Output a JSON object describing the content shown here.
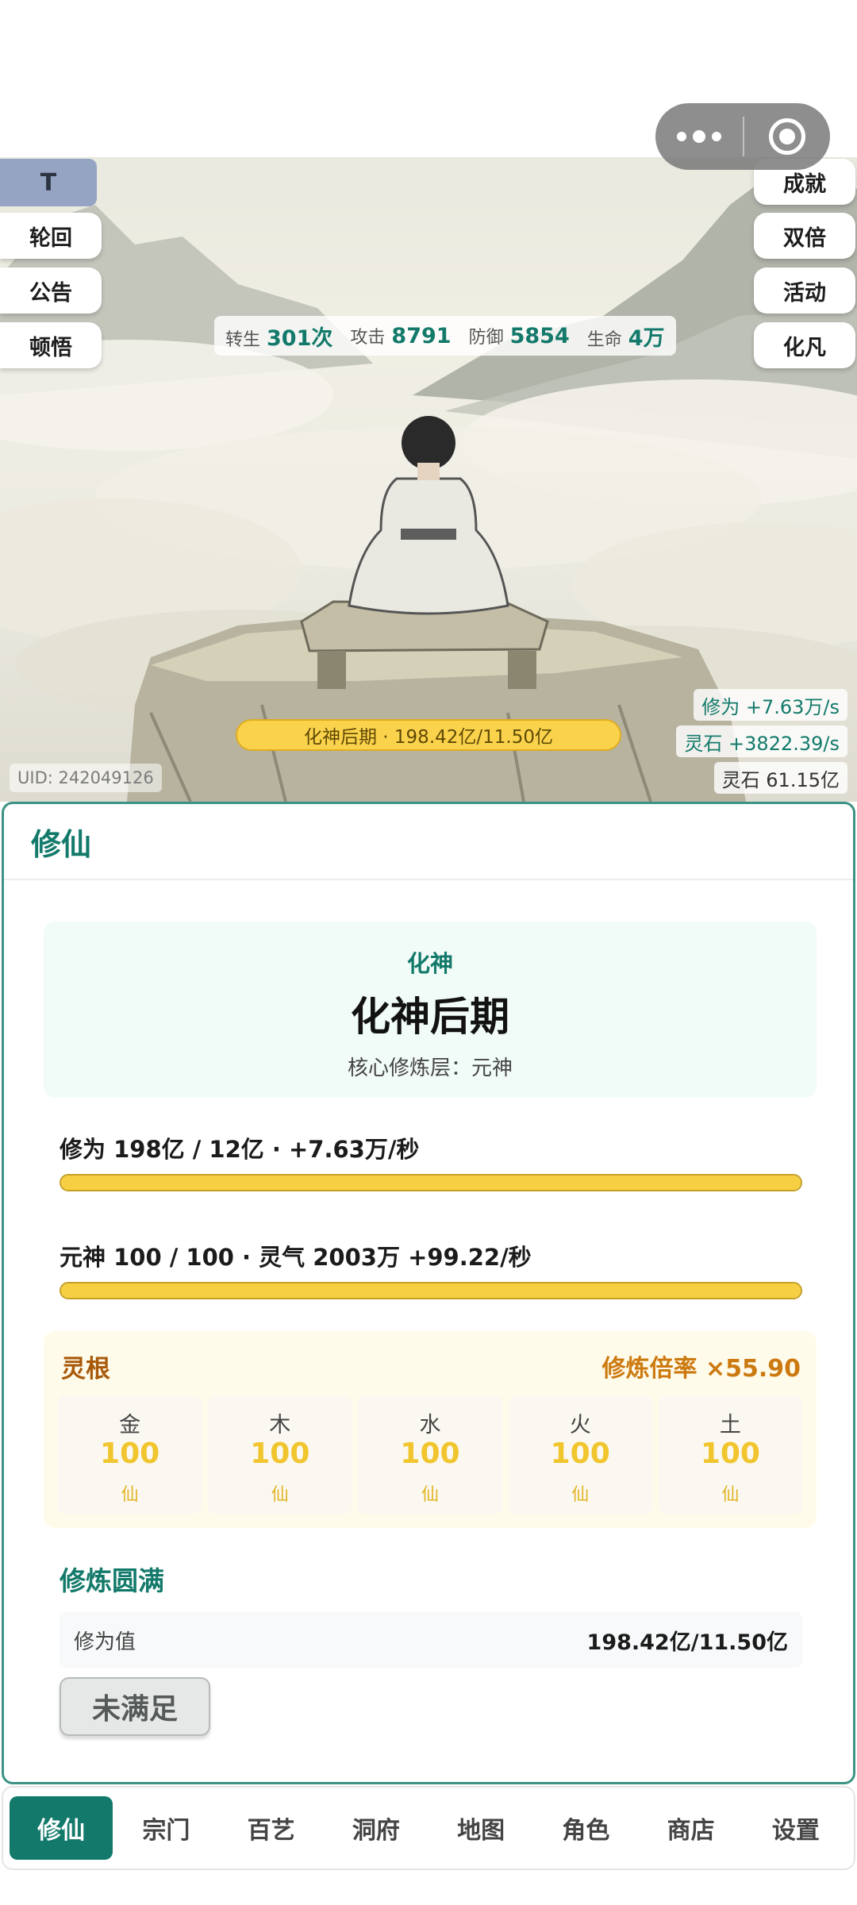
{
  "top_stats": [
    {
      "label": "转生",
      "value": "301次"
    },
    {
      "label": "攻击",
      "value": "8791"
    },
    {
      "label": "防御",
      "value": "5854"
    },
    {
      "label": "生命",
      "value": "4万"
    }
  ],
  "left_buttons": {
    "t": "T",
    "reincarnate": "轮回",
    "notice": "公告",
    "insight": "顿悟"
  },
  "right_buttons": {
    "achievement": "成就",
    "double": "双倍",
    "event": "活动",
    "mortal": "化凡"
  },
  "scene": {
    "realm_bar": "化神后期 · 198.42亿/11.50亿",
    "cultivation_rate": "修为 +7.63万/s",
    "stone_rate": "灵石 +3822.39/s",
    "stone_total": "灵石 61.15亿",
    "uid": "UID: 242049126"
  },
  "panel": {
    "title": "修仙",
    "realm_major": "化神",
    "realm_minor": "化神后期",
    "core_layer": "核心修炼层：元神",
    "cultivation_text": "修为 198亿 / 12亿 · +7.63万/秒",
    "cultivation_progress": 1.0,
    "spirit_text": "元神 100 / 100 · 灵气 2003万 +99.22/秒",
    "spirit_progress": 1.0
  },
  "spirit_root": {
    "title": "灵根",
    "rate": "修炼倍率 ×55.90",
    "elements": [
      {
        "name": "金",
        "value": "100",
        "grade": "仙"
      },
      {
        "name": "木",
        "value": "100",
        "grade": "仙"
      },
      {
        "name": "水",
        "value": "100",
        "grade": "仙"
      },
      {
        "name": "火",
        "value": "100",
        "grade": "仙"
      },
      {
        "name": "土",
        "value": "100",
        "grade": "仙"
      }
    ]
  },
  "perfection": {
    "title": "修炼圆满",
    "label": "修为值",
    "value": "198.42亿/11.50亿",
    "button": "未满足"
  },
  "nav": [
    "修仙",
    "宗门",
    "百艺",
    "洞府",
    "地图",
    "角色",
    "商店",
    "设置"
  ],
  "colors": {
    "accent": "#137a6b",
    "gold": "#f7cf42",
    "root_title": "#a85a0a"
  }
}
